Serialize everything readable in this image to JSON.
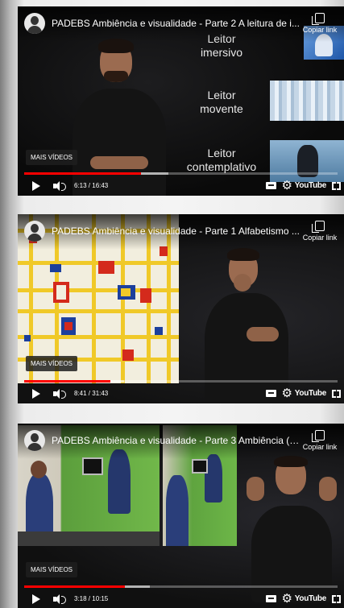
{
  "videos": [
    {
      "title": "PADEBS Ambiência e visualidade - Parte 2 A leitura de i...",
      "copy_link": "Copiar link",
      "more_videos": "MAIS VÍDEOS",
      "time": "6:13 / 16:43",
      "progress_fraction": 0.372,
      "side_labels": [
        "Leitor\nimersivo",
        "Leitor\nmovente",
        "Leitor\ncontemplativo"
      ],
      "youtube": "YouTube"
    },
    {
      "title": "PADEBS Ambiência e visualidade - Parte 1 Alfabetismo ...",
      "copy_link": "Copiar link",
      "more_videos": "MAIS VÍDEOS",
      "time": "8:41 / 31:43",
      "progress_fraction": 0.274,
      "youtube": "YouTube"
    },
    {
      "title": "PADEBS Ambiência e visualidade - Parte 3 Ambiência (L...",
      "copy_link": "Copiar link",
      "more_videos": "MAIS VÍDEOS",
      "time": "3:18 / 10:15",
      "progress_fraction": 0.322,
      "youtube": "YouTube"
    }
  ],
  "colors": {
    "progress_played": "#ff0000",
    "background": "#f4f4f4"
  }
}
